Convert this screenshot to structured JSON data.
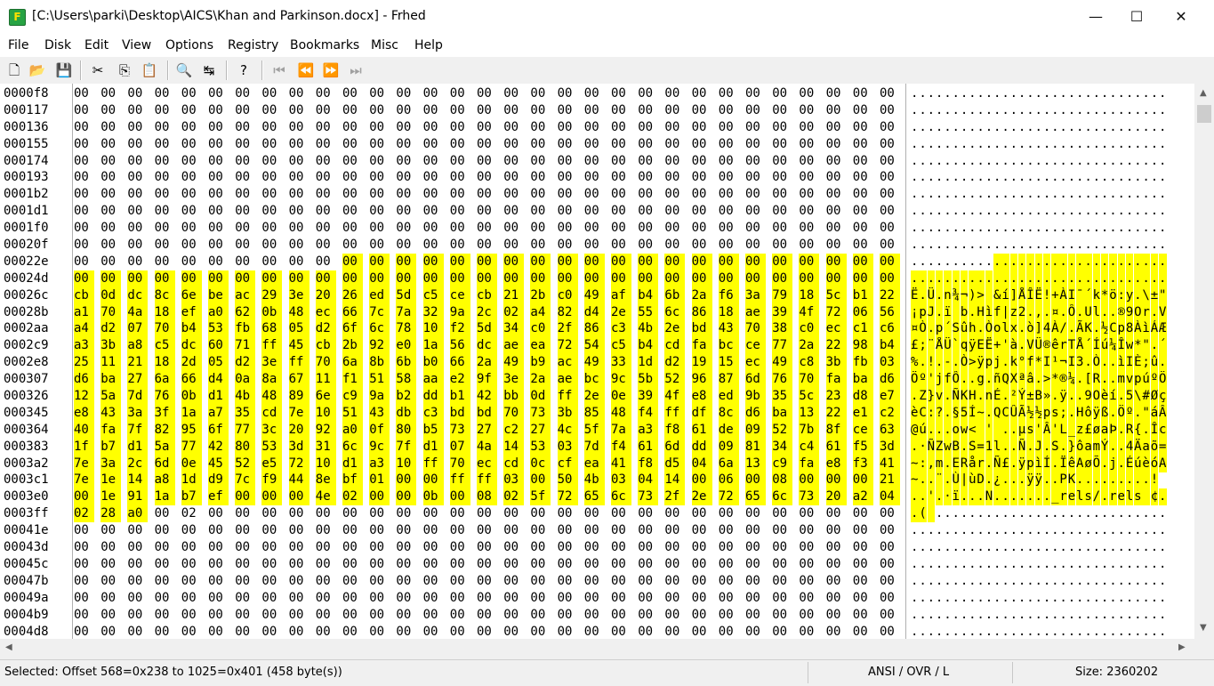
{
  "window": {
    "title": "[C:\\Users\\parki\\Desktop\\AICS\\Khan and Parkinson.docx] - Frhed",
    "app_icon_letter": "F",
    "minimize_glyph": "—",
    "maximize_glyph": "☐",
    "close_glyph": "✕"
  },
  "menu": [
    "File",
    "Disk",
    "Edit",
    "View",
    "Options",
    "Registry",
    "Bookmarks",
    "Misc",
    "Help"
  ],
  "toolbar": {
    "icons": [
      {
        "name": "new-file-icon",
        "glyph": "🗋",
        "enabled": true
      },
      {
        "name": "open-folder-icon",
        "glyph": "📂",
        "enabled": true
      },
      {
        "name": "save-icon",
        "glyph": "💾",
        "enabled": true
      },
      {
        "name": "cut-icon",
        "glyph": "✂",
        "enabled": true
      },
      {
        "name": "copy-icon",
        "glyph": "⎘",
        "enabled": true
      },
      {
        "name": "paste-icon",
        "glyph": "📋",
        "enabled": true
      },
      {
        "name": "find-icon",
        "glyph": "🔍",
        "enabled": true
      },
      {
        "name": "replace-icon",
        "glyph": "↹",
        "enabled": true
      },
      {
        "name": "help-icon",
        "glyph": "?",
        "enabled": true
      },
      {
        "name": "first-page-icon",
        "glyph": "⏮",
        "enabled": false
      },
      {
        "name": "prev-page-icon",
        "glyph": "⏪",
        "enabled": false
      },
      {
        "name": "next-page-icon",
        "glyph": "⏩",
        "enabled": false
      },
      {
        "name": "last-page-icon",
        "glyph": "⏭",
        "enabled": false
      }
    ]
  },
  "hex": {
    "selection": {
      "start": 568,
      "end": 1025
    },
    "rows": [
      {
        "offset": "0000f8",
        "bytes": "00 00 00 00 00 00 00 00 00 00 00 00 00 00 00 00 00 00 00 00 00 00 00 00 00 00 00 00 00 00 00",
        "ascii": "..............................."
      },
      {
        "offset": "000117",
        "bytes": "00 00 00 00 00 00 00 00 00 00 00 00 00 00 00 00 00 00 00 00 00 00 00 00 00 00 00 00 00 00 00",
        "ascii": "..............................."
      },
      {
        "offset": "000136",
        "bytes": "00 00 00 00 00 00 00 00 00 00 00 00 00 00 00 00 00 00 00 00 00 00 00 00 00 00 00 00 00 00 00",
        "ascii": "..............................."
      },
      {
        "offset": "000155",
        "bytes": "00 00 00 00 00 00 00 00 00 00 00 00 00 00 00 00 00 00 00 00 00 00 00 00 00 00 00 00 00 00 00",
        "ascii": "..............................."
      },
      {
        "offset": "000174",
        "bytes": "00 00 00 00 00 00 00 00 00 00 00 00 00 00 00 00 00 00 00 00 00 00 00 00 00 00 00 00 00 00 00",
        "ascii": "..............................."
      },
      {
        "offset": "000193",
        "bytes": "00 00 00 00 00 00 00 00 00 00 00 00 00 00 00 00 00 00 00 00 00 00 00 00 00 00 00 00 00 00 00",
        "ascii": "..............................."
      },
      {
        "offset": "0001b2",
        "bytes": "00 00 00 00 00 00 00 00 00 00 00 00 00 00 00 00 00 00 00 00 00 00 00 00 00 00 00 00 00 00 00",
        "ascii": "..............................."
      },
      {
        "offset": "0001d1",
        "bytes": "00 00 00 00 00 00 00 00 00 00 00 00 00 00 00 00 00 00 00 00 00 00 00 00 00 00 00 00 00 00 00",
        "ascii": "..............................."
      },
      {
        "offset": "0001f0",
        "bytes": "00 00 00 00 00 00 00 00 00 00 00 00 00 00 00 00 00 00 00 00 00 00 00 00 00 00 00 00 00 00 00",
        "ascii": "..............................."
      },
      {
        "offset": "00020f",
        "bytes": "00 00 00 00 00 00 00 00 00 00 00 00 00 00 00 00 00 00 00 00 00 00 00 00 00 00 00 00 00 00 00",
        "ascii": "..............................."
      },
      {
        "offset": "00022e",
        "bytes": "00 00 00 00 00 00 00 00 00 00 00 00 00 00 00 00 00 00 00 00 00 00 00 00 00 00 00 00 00 00 00",
        "ascii": "..............................."
      },
      {
        "offset": "00024d",
        "bytes": "00 00 00 00 00 00 00 00 00 00 00 00 00 00 00 00 00 00 00 00 00 00 00 00 00 00 00 00 00 00 00",
        "ascii": "..............................."
      },
      {
        "offset": "00026c",
        "bytes": "cb 0d dc 8c 6e be ac 29 3e 20 26 ed 5d c5 ce cb 21 2b c0 49 af b4 6b 2a f6 3a 79 18 5c b1 22",
        "ascii": "Ë.Ü.n¾¬)> &í]ÅÎË!+ÀI¯´k*ö:y.\\±\""
      },
      {
        "offset": "00028b",
        "bytes": "a1 70 4a 18 ef a0 62 0b 48 ec 66 7c 7a 32 9a 2c 02 a4 82 d4 2e 55 6c 86 18 ae 39 4f 72 06 56",
        "ascii": "¡pJ.ï b.Hìf|z2.,.¤.Ô.Ul..®9Or.V"
      },
      {
        "offset": "0002aa",
        "bytes": "a4 d2 07 70 b4 53 fb 68 05 d2 6f 6c 78 10 f2 5d 34 c0 2f 86 c3 4b 2e bd 43 70 38 c0 ec c1 c6",
        "ascii": "¤Ò.p´Sûh.Òolx.ò]4À/.ÃK.½Cp8ÀìÁÆ"
      },
      {
        "offset": "0002c9",
        "bytes": "a3 3b a8 c5 dc 60 71 ff 45 cb 2b 92 e0 1a 56 dc ae ea 72 54 c5 b4 cd fa bc ce 77 2a 22 98 b4",
        "ascii": "£;¨ÅÜ`qÿEË+'à.VÜ®êrTÅ´Íú¼Îw*\".´"
      },
      {
        "offset": "0002e8",
        "bytes": "25 11 21 18 2d 05 d2 3e ff 70 6a 8b 6b b0 66 2a 49 b9 ac 49 33 1d d2 19 15 ec 49 c8 3b fb 03",
        "ascii": "%.!.-.Ò>ÿpj.k°f*I¹¬I3.Ò..ìIÈ;û."
      },
      {
        "offset": "000307",
        "bytes": "d6 ba 27 6a 66 d4 0a 8a 67 11 f1 51 58 aa e2 9f 3e 2a ae bc 9c 5b 52 96 87 6d 76 70 fa ba d6",
        "ascii": "Öº'jfÔ..g.ñQXªâ.>*®¼.[R..mvpúºÖ"
      },
      {
        "offset": "000326",
        "bytes": "12 5a 7d 76 0b d1 4b 48 89 6e c9 9a b2 dd b1 42 bb 0d ff 2e 0e 39 4f e8 ed 9b 35 5c 23 d8 e7",
        "ascii": ".Z}v.ÑKH.nÉ.²Ý±B».ÿ..9Oèí.5\\#Øç"
      },
      {
        "offset": "000345",
        "bytes": "e8 43 3a 3f 1a a7 35 cd 7e 10 51 43 db c3 bd bd 70 73 3b 85 48 f4 ff df 8c d6 ba 13 22 e1 c2",
        "ascii": "èC:?.§5Í~.QCÛÃ½½ps;.Hôÿß.Öº.\"áÂ"
      },
      {
        "offset": "000364",
        "bytes": "40 fa 7f 82 95 6f 77 3c 20 92 a0 0f 80 b5 73 27 c2 27 4c 5f 7a a3 f8 61 de 09 52 7b 8f ce 63",
        "ascii": "@ú...ow< ' ..µs'Â'L_z£øaÞ.R{.Îc"
      },
      {
        "offset": "000383",
        "bytes": "1f b7 d1 5a 77 42 80 53 3d 31 6c 9c 7f d1 07 4a 14 53 03 7d f4 61 6d dd 09 81 34 c4 61 f5 3d",
        "ascii": ".·ÑZwB.S=1l..Ñ.J.S.}ôamÝ..4Äaõ="
      },
      {
        "offset": "0003a2",
        "bytes": "7e 3a 2c 6d 0e 45 52 e5 72 10 d1 a3 10 ff 70 ec cd 0c cf ea 41 f8 d5 04 6a 13 c9 fa e8 f3 41",
        "ascii": "~:,m.ERår.Ñ£.ÿpìÍ.ÏêAøÕ.j.ÉúèóA"
      },
      {
        "offset": "0003c1",
        "bytes": "7e 1e 14 a8 1d d9 7c f9 44 8e bf 01 00 00 ff ff 03 00 50 4b 03 04 14 00 06 00 08 00 00 00 21",
        "ascii": "~..¨.Ù|ùD.¿...ÿÿ..PK.........!"
      },
      {
        "offset": "0003e0",
        "bytes": "00 1e 91 1a b7 ef 00 00 00 4e 02 00 00 0b 00 08 02 5f 72 65 6c 73 2f 2e 72 65 6c 73 20 a2 04",
        "ascii": "..'.·ï...N......._rels/.rels ¢."
      },
      {
        "offset": "0003ff",
        "bytes": "02 28 a0 00 02 00 00 00 00 00 00 00 00 00 00 00 00 00 00 00 00 00 00 00 00 00 00 00 00 00 00",
        "ascii": ".( ............................"
      },
      {
        "offset": "00041e",
        "bytes": "00 00 00 00 00 00 00 00 00 00 00 00 00 00 00 00 00 00 00 00 00 00 00 00 00 00 00 00 00 00 00",
        "ascii": "..............................."
      },
      {
        "offset": "00043d",
        "bytes": "00 00 00 00 00 00 00 00 00 00 00 00 00 00 00 00 00 00 00 00 00 00 00 00 00 00 00 00 00 00 00",
        "ascii": "..............................."
      },
      {
        "offset": "00045c",
        "bytes": "00 00 00 00 00 00 00 00 00 00 00 00 00 00 00 00 00 00 00 00 00 00 00 00 00 00 00 00 00 00 00",
        "ascii": "..............................."
      },
      {
        "offset": "00047b",
        "bytes": "00 00 00 00 00 00 00 00 00 00 00 00 00 00 00 00 00 00 00 00 00 00 00 00 00 00 00 00 00 00 00",
        "ascii": "..............................."
      },
      {
        "offset": "00049a",
        "bytes": "00 00 00 00 00 00 00 00 00 00 00 00 00 00 00 00 00 00 00 00 00 00 00 00 00 00 00 00 00 00 00",
        "ascii": "..............................."
      },
      {
        "offset": "0004b9",
        "bytes": "00 00 00 00 00 00 00 00 00 00 00 00 00 00 00 00 00 00 00 00 00 00 00 00 00 00 00 00 00 00 00",
        "ascii": "..............................."
      },
      {
        "offset": "0004d8",
        "bytes": "00 00 00 00 00 00 00 00 00 00 00 00 00 00 00 00 00 00 00 00 00 00 00 00 00 00 00 00 00 00 00",
        "ascii": "..............................."
      }
    ]
  },
  "status": {
    "selection_text": "Selected: Offset 568=0x238 to 1025=0x401 (458 byte(s))",
    "mode": "ANSI / OVR / L",
    "size": "Size: 2360202"
  },
  "scroll": {
    "up": "▲",
    "down": "▼",
    "left": "◀",
    "right": "▶"
  },
  "colors": {
    "selection": "#ffff00",
    "app_icon": "#27a343"
  }
}
